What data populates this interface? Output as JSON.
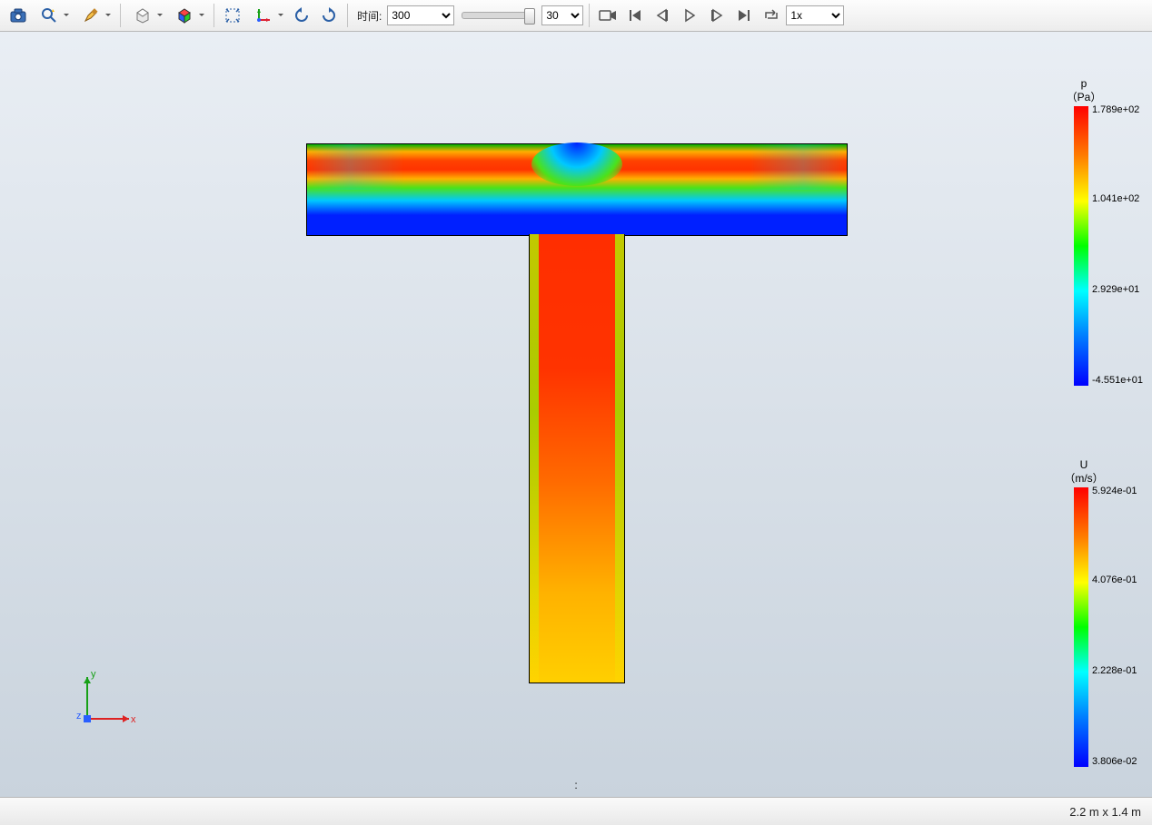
{
  "toolbar": {
    "time_label": "时间:",
    "time_value": "300",
    "frame_value": "30",
    "speed_value": "1x"
  },
  "legends": {
    "p": {
      "title": "p\n（Pa）",
      "ticks": [
        "1.789e+02",
        "1.041e+02",
        "2.929e+01",
        "-4.551e+01"
      ]
    },
    "u": {
      "title": "U\n（m/s）",
      "ticks": [
        "5.924e-01",
        "4.076e-01",
        "2.228e-01",
        "3.806e-02"
      ]
    }
  },
  "triad": {
    "x": "x",
    "y": "y",
    "z": "z"
  },
  "viewport": {
    "colon": ":"
  },
  "status": {
    "dims": "2.2 m x 1.4 m"
  }
}
